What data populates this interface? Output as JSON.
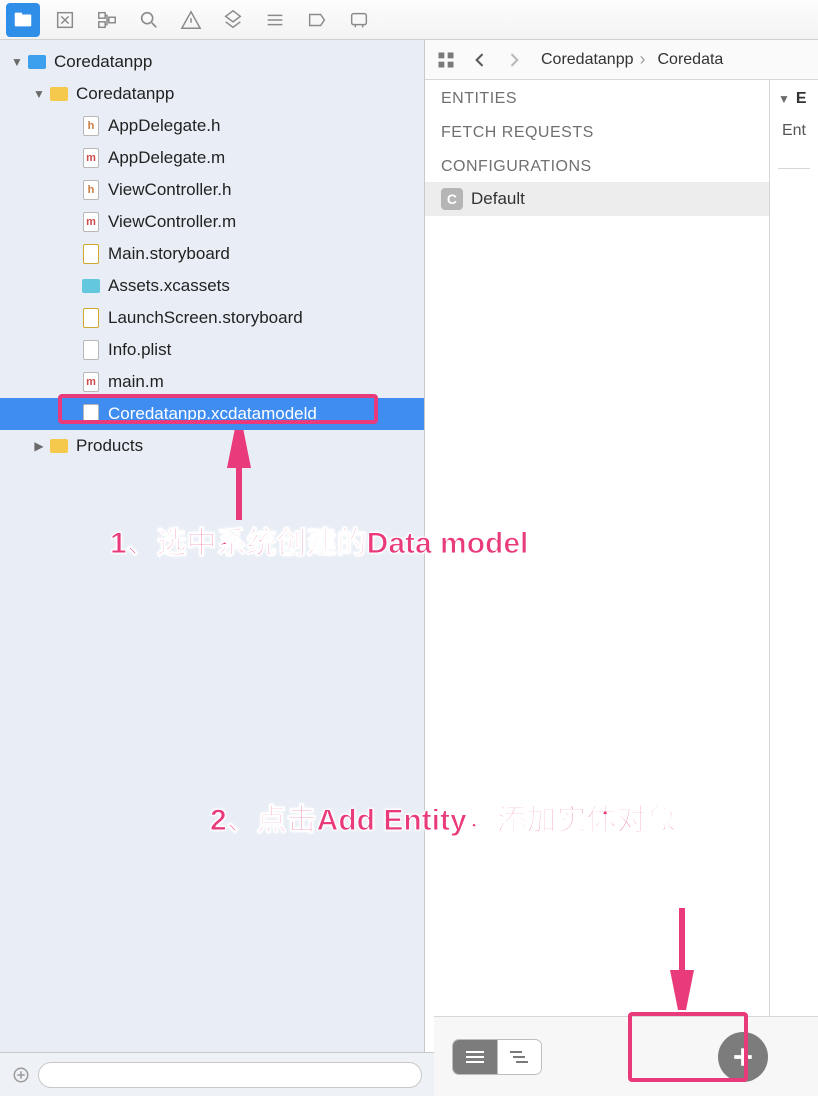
{
  "toolbar_icons": [
    "folder",
    "box",
    "tree",
    "search",
    "warning",
    "diamond",
    "lines",
    "tag",
    "comment"
  ],
  "project": {
    "root": "Coredatanpp",
    "group": "Coredatanpp",
    "files": [
      {
        "name": "AppDelegate.h",
        "type": "h"
      },
      {
        "name": "AppDelegate.m",
        "type": "m"
      },
      {
        "name": "ViewController.h",
        "type": "h"
      },
      {
        "name": "ViewController.m",
        "type": "m"
      },
      {
        "name": "Main.storyboard",
        "type": "sb"
      },
      {
        "name": "Assets.xcassets",
        "type": "xcassets"
      },
      {
        "name": "LaunchScreen.storyboard",
        "type": "sb"
      },
      {
        "name": "Info.plist",
        "type": "plist"
      },
      {
        "name": "main.m",
        "type": "m"
      },
      {
        "name": "Coredatanpp.xcdatamodeld",
        "type": "model",
        "selected": true
      }
    ],
    "products_label": "Products"
  },
  "jumpbar": {
    "crumb1": "Coredatanpp",
    "crumb2": "Coredata"
  },
  "sections": {
    "entities": "ENTITIES",
    "fetch": "FETCH REQUESTS",
    "configs": "CONFIGURATIONS",
    "default_config": "Default"
  },
  "inspector": {
    "header_prefix": "E",
    "row1": "Ent"
  },
  "annotations": {
    "text1": "1、选中系统创建的Data model",
    "text2": "2、点击Add Entity，添加实体对象"
  }
}
